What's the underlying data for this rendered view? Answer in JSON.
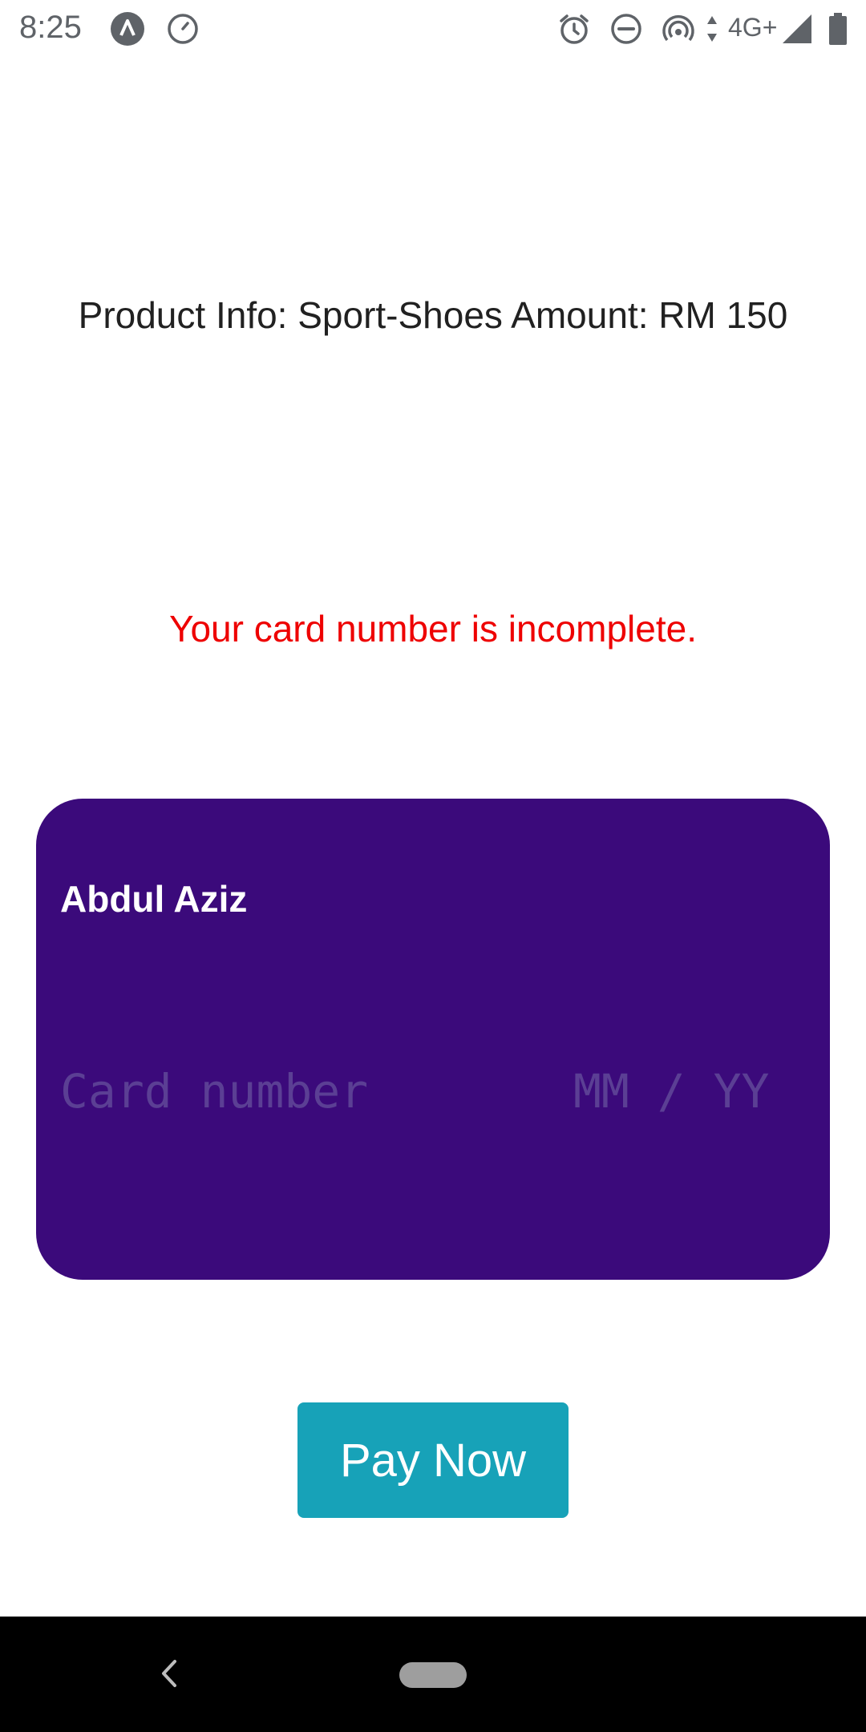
{
  "status_bar": {
    "time": "8:25",
    "network": "4G+",
    "icons": [
      "navigation-icon",
      "timer-icon",
      "alarm-icon",
      "do-not-disturb-icon",
      "hotspot-icon",
      "data-arrows-icon",
      "signal-icon",
      "battery-icon"
    ]
  },
  "product": {
    "info_text": "Product Info: Sport-Shoes Amount: RM 150"
  },
  "error": {
    "message": "Your card number is incomplete."
  },
  "card": {
    "holder_name": "Abdul Aziz",
    "number_value": "",
    "number_placeholder": "Card number",
    "expiry_value": "",
    "expiry_placeholder": "MM / YY",
    "background_color": "#3b0a7b"
  },
  "actions": {
    "pay_label": "Pay Now",
    "button_color": "#17a2b8"
  },
  "nav": {
    "icons": [
      "back-icon",
      "home-pill-icon"
    ]
  }
}
